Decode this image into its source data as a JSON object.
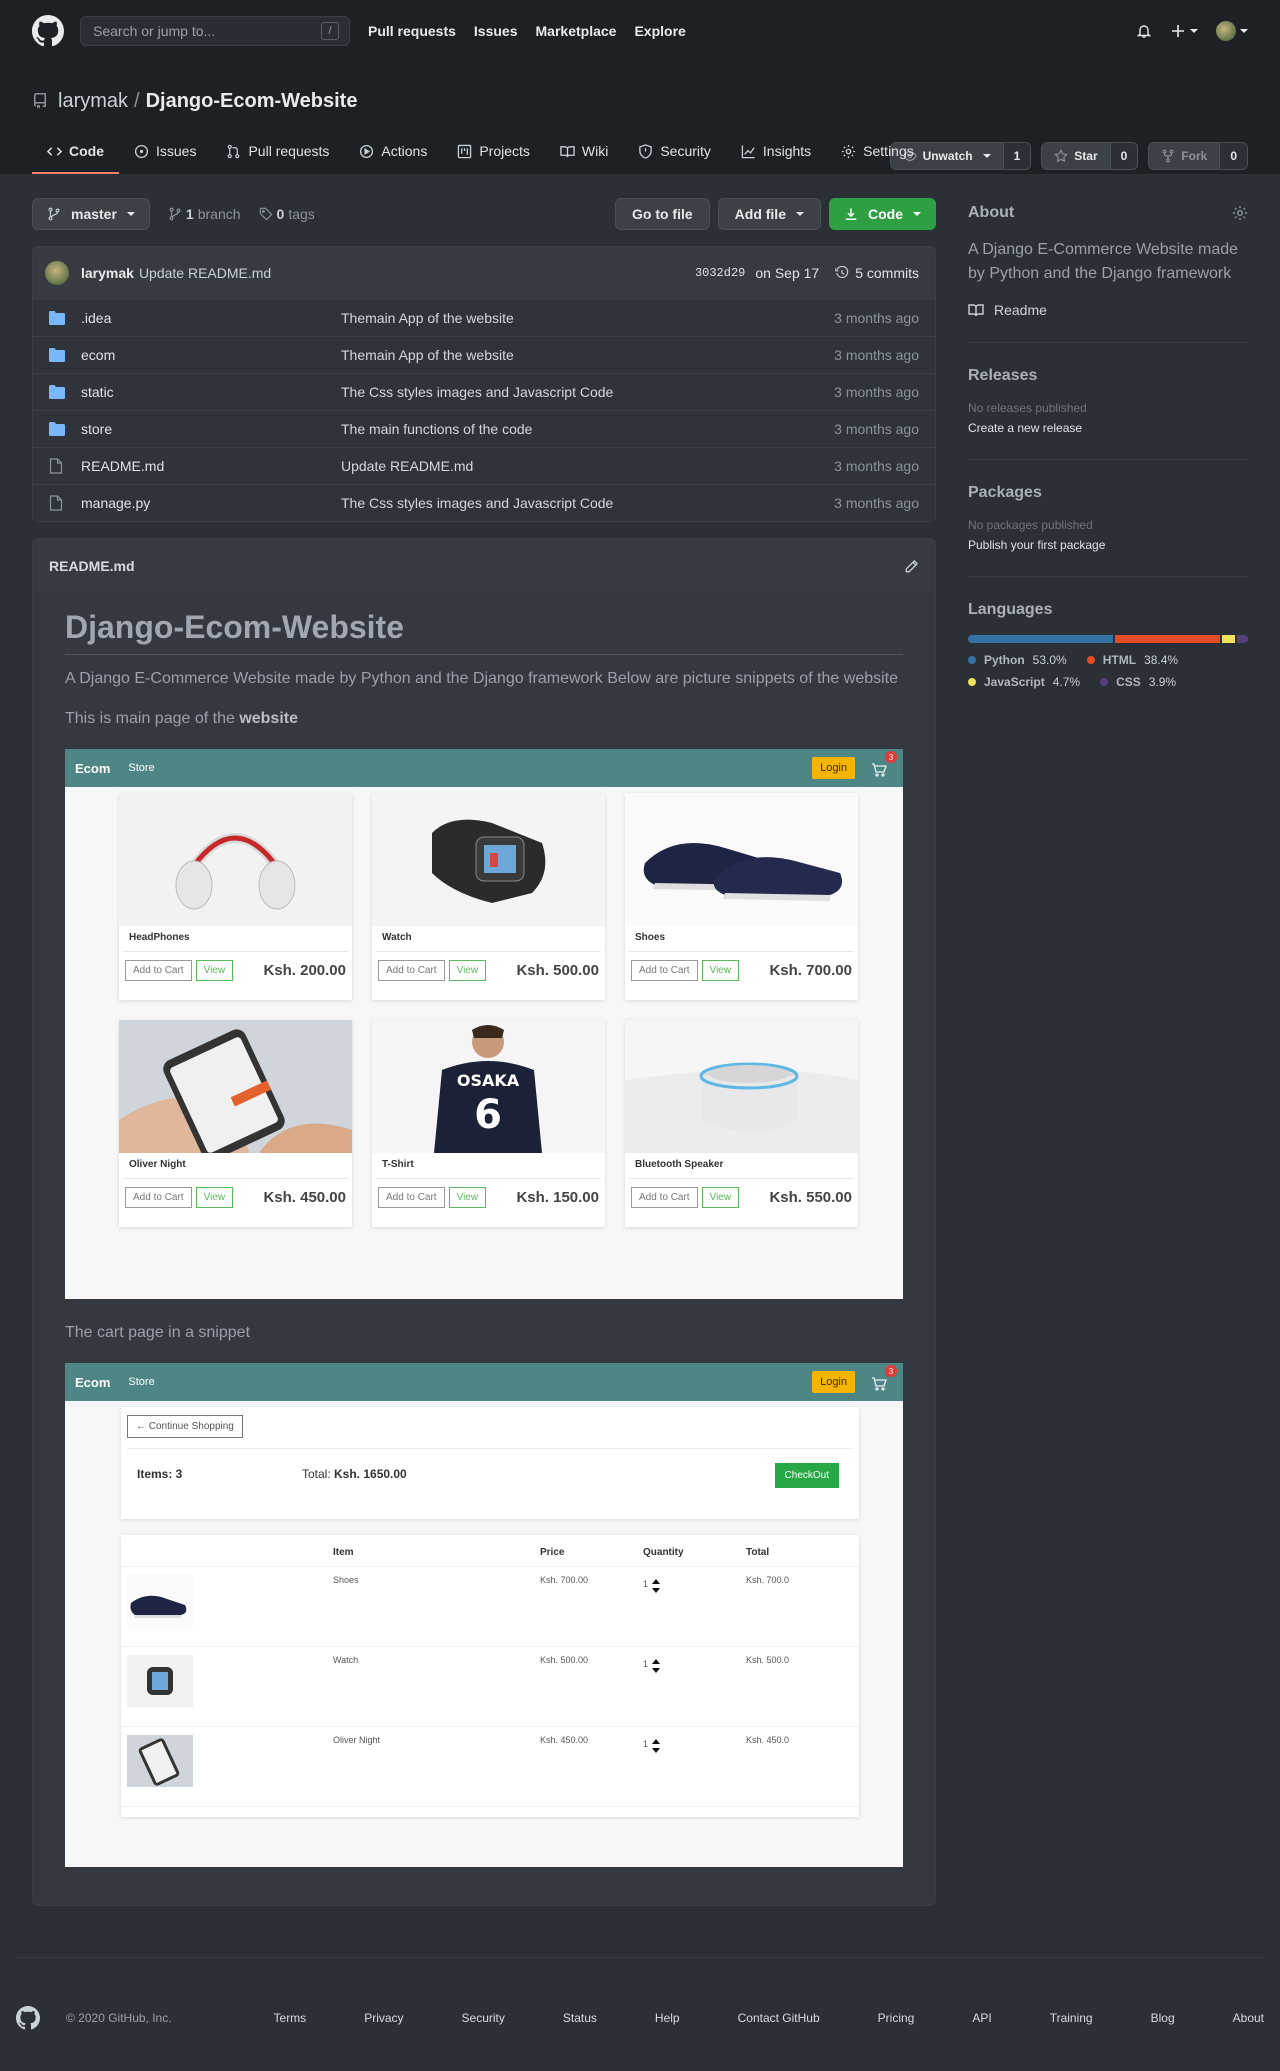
{
  "header": {
    "search_placeholder": "Search or jump to...",
    "slash_key": "/",
    "nav": [
      "Pull requests",
      "Issues",
      "Marketplace",
      "Explore"
    ]
  },
  "repo": {
    "owner": "larymak",
    "separator": "/",
    "name": "Django-Ecom-Website",
    "watch_label": "Unwatch",
    "watch_count": "1",
    "star_label": "Star",
    "star_count": "0",
    "fork_label": "Fork",
    "fork_count": "0",
    "tabs": [
      "Code",
      "Issues",
      "Pull requests",
      "Actions",
      "Projects",
      "Wiki",
      "Security",
      "Insights",
      "Settings"
    ]
  },
  "branchbar": {
    "branch": "master",
    "branch_count": "1",
    "branch_word": "branch",
    "tag_count": "0",
    "tag_word": "tags",
    "goto_file": "Go to file",
    "add_file": "Add file",
    "code": "Code"
  },
  "commit": {
    "user": "larymak",
    "message": "Update README.md",
    "sha": "3032d29",
    "date": "on Sep 17",
    "commits": "5 commits"
  },
  "files": [
    {
      "name": ".idea",
      "type": "dir",
      "message": "Themain App of the website",
      "age": "3 months ago"
    },
    {
      "name": "ecom",
      "type": "dir",
      "message": "Themain App of the website",
      "age": "3 months ago"
    },
    {
      "name": "static",
      "type": "dir",
      "message": "The Css styles images and Javascript Code",
      "age": "3 months ago"
    },
    {
      "name": "store",
      "type": "dir",
      "message": "The main functions of the code",
      "age": "3 months ago"
    },
    {
      "name": "README.md",
      "type": "file",
      "message": "Update README.md",
      "age": "3 months ago"
    },
    {
      "name": "manage.py",
      "type": "file",
      "message": "The Css styles images and Javascript Code",
      "age": "3 months ago"
    }
  ],
  "readme": {
    "filename": "README.md",
    "h1": "Django-Ecom-Website",
    "p1": "A Django E-Commerce Website made by Python and the Django framework Below are picture snippets of the website",
    "p2_pre": "This is main page of the ",
    "p2_bold": "website",
    "p3": "The cart page in a snippet"
  },
  "shop": {
    "brand": "Ecom",
    "store": "Store",
    "login": "Login",
    "cart_badge": "3",
    "add_to_cart": "Add to Cart",
    "view": "View",
    "products": [
      {
        "title": "HeadPhones",
        "price": "Ksh. 200.00"
      },
      {
        "title": "Watch",
        "price": "Ksh. 500.00"
      },
      {
        "title": "Shoes",
        "price": "Ksh. 700.00"
      },
      {
        "title": "Oliver Night",
        "price": "Ksh. 450.00"
      },
      {
        "title": "T-Shirt",
        "price": "Ksh. 150.00"
      },
      {
        "title": "Bluetooth Speaker",
        "price": "Ksh. 550.00"
      }
    ]
  },
  "cart": {
    "continue": "← Continue Shopping",
    "items_label": "Items: 3",
    "total_label": "Total: ",
    "total_value": "Ksh. 1650.00",
    "checkout": "CheckOut",
    "headers": [
      "Item",
      "Price",
      "Quantity",
      "Total"
    ],
    "rows": [
      {
        "item": "Shoes",
        "price": "Ksh. 700.00",
        "qty": "1",
        "total": "Ksh. 700.0"
      },
      {
        "item": "Watch",
        "price": "Ksh. 500.00",
        "qty": "1",
        "total": "Ksh. 500.0"
      },
      {
        "item": "Oliver Night",
        "price": "Ksh. 450.00",
        "qty": "1",
        "total": "Ksh. 450.0"
      }
    ]
  },
  "sidebar": {
    "about_title": "About",
    "about_text": "A Django E-Commerce Website made by Python and the Django framework",
    "readme_link": "Readme",
    "releases_title": "Releases",
    "releases_none": "No releases published",
    "releases_create": "Create a new release",
    "packages_title": "Packages",
    "packages_none": "No packages published",
    "packages_publish": "Publish your first package",
    "languages_title": "Languages",
    "languages": [
      {
        "name": "Python",
        "percent": "53.0%",
        "value": 53.0,
        "color": "#3572A5"
      },
      {
        "name": "HTML",
        "percent": "38.4%",
        "value": 38.4,
        "color": "#e34c26"
      },
      {
        "name": "JavaScript",
        "percent": "4.7%",
        "value": 4.7,
        "color": "#f1e05a"
      },
      {
        "name": "CSS",
        "percent": "3.9%",
        "value": 3.9,
        "color": "#563d7c"
      }
    ]
  },
  "footer": {
    "copyright": "© 2020 GitHub, Inc.",
    "links": [
      "Terms",
      "Privacy",
      "Security",
      "Status",
      "Help",
      "Contact GitHub",
      "Pricing",
      "API",
      "Training",
      "Blog",
      "About"
    ]
  }
}
